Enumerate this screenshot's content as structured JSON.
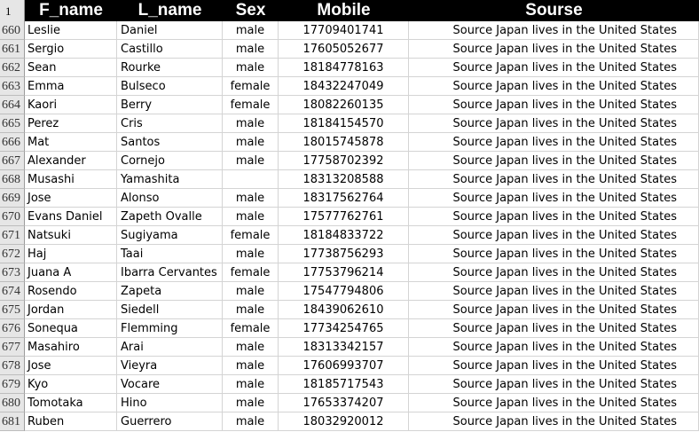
{
  "header": {
    "row_number": "1",
    "columns": [
      "F_name",
      "L_name",
      "Sex",
      "Mobile",
      "Sourse"
    ]
  },
  "rows": [
    {
      "n": "660",
      "f": "Leslie",
      "l": "Daniel",
      "s": "male",
      "m": "17709401741",
      "so": "Source Japan lives in the United States"
    },
    {
      "n": "661",
      "f": "Sergio",
      "l": "Castillo",
      "s": "male",
      "m": "17605052677",
      "so": "Source Japan lives in the United States"
    },
    {
      "n": "662",
      "f": "Sean",
      "l": "Rourke",
      "s": "male",
      "m": "18184778163",
      "so": "Source Japan lives in the United States"
    },
    {
      "n": "663",
      "f": "Emma",
      "l": "Bulseco",
      "s": "female",
      "m": "18432247049",
      "so": "Source Japan lives in the United States"
    },
    {
      "n": "664",
      "f": "Kaori",
      "l": "Berry",
      "s": "female",
      "m": "18082260135",
      "so": "Source Japan lives in the United States"
    },
    {
      "n": "665",
      "f": "Perez",
      "l": "Cris",
      "s": "male",
      "m": "18184154570",
      "so": "Source Japan lives in the United States"
    },
    {
      "n": "666",
      "f": "Mat",
      "l": "Santos",
      "s": "male",
      "m": "18015745878",
      "so": "Source Japan lives in the United States"
    },
    {
      "n": "667",
      "f": "Alexander",
      "l": "Cornejo",
      "s": "male",
      "m": "17758702392",
      "so": "Source Japan lives in the United States"
    },
    {
      "n": "668",
      "f": "Musashi",
      "l": "Yamashita",
      "s": "",
      "m": "18313208588",
      "so": "Source Japan lives in the United States"
    },
    {
      "n": "669",
      "f": "Jose",
      "l": "Alonso",
      "s": "male",
      "m": "18317562764",
      "so": "Source Japan lives in the United States"
    },
    {
      "n": "670",
      "f": "Evans Daniel",
      "l": "Zapeth Ovalle",
      "s": "male",
      "m": "17577762761",
      "so": "Source Japan lives in the United States"
    },
    {
      "n": "671",
      "f": "Natsuki",
      "l": "Sugiyama",
      "s": "female",
      "m": "18184833722",
      "so": "Source Japan lives in the United States"
    },
    {
      "n": "672",
      "f": "Haj",
      "l": "Taai",
      "s": "male",
      "m": "17738756293",
      "so": "Source Japan lives in the United States"
    },
    {
      "n": "673",
      "f": "Juana A",
      "l": "Ibarra Cervantes",
      "s": "female",
      "m": "17753796214",
      "so": "Source Japan lives in the United States"
    },
    {
      "n": "674",
      "f": "Rosendo",
      "l": "Zapeta",
      "s": "male",
      "m": "17547794806",
      "so": "Source Japan lives in the United States"
    },
    {
      "n": "675",
      "f": "Jordan",
      "l": "Siedell",
      "s": "male",
      "m": "18439062610",
      "so": "Source Japan lives in the United States"
    },
    {
      "n": "676",
      "f": "Sonequa",
      "l": "Flemming",
      "s": "female",
      "m": "17734254765",
      "so": "Source Japan lives in the United States"
    },
    {
      "n": "677",
      "f": "Masahiro",
      "l": "Arai",
      "s": "male",
      "m": "18313342157",
      "so": "Source Japan lives in the United States"
    },
    {
      "n": "678",
      "f": "Jose",
      "l": "Vieyra",
      "s": "male",
      "m": "17606993707",
      "so": "Source Japan lives in the United States"
    },
    {
      "n": "679",
      "f": "Kyo",
      "l": "Vocare",
      "s": "male",
      "m": "18185717543",
      "so": "Source Japan lives in the United States"
    },
    {
      "n": "680",
      "f": "Tomotaka",
      "l": "Hino",
      "s": "male",
      "m": "17653374207",
      "so": "Source Japan lives in the United States"
    },
    {
      "n": "681",
      "f": "Ruben",
      "l": "Guerrero",
      "s": "male",
      "m": "18032920012",
      "so": "Source Japan lives in the United States"
    }
  ]
}
